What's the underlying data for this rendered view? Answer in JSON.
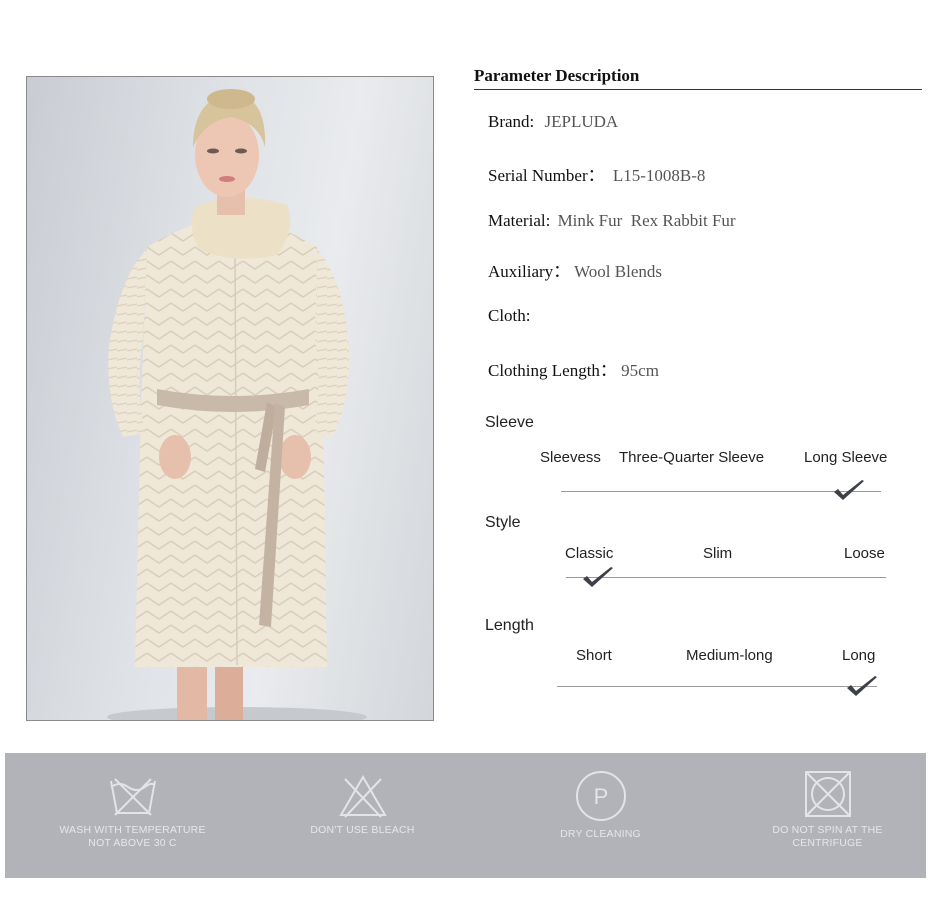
{
  "parameter": {
    "title": "Parameter Description",
    "brand_label": "Brand:",
    "brand_value": "JEPLUDA",
    "serial_label": "Serial Number：",
    "serial_value": "L15-1008B-8",
    "material_label": "Material:",
    "material_value": "Mink Fur  Rex Rabbit Fur",
    "auxiliary_label": "Auxiliary：",
    "auxiliary_value": "Wool Blends",
    "cloth_label": "Cloth:",
    "length_label": "Clothing Length：",
    "length_value": "95cm"
  },
  "sleeve": {
    "title": "Sleeve",
    "options": [
      "Sleevess",
      "Three-Quarter Sleeve",
      "Long Sleeve"
    ],
    "selected": "Long Sleeve"
  },
  "style": {
    "title": "Style",
    "options": [
      "Classic",
      "Slim",
      "Loose"
    ],
    "selected": "Classic"
  },
  "length": {
    "title": "Length",
    "options": [
      "Short",
      "Medium-long",
      "Long"
    ],
    "selected": "Long"
  },
  "care": {
    "wash": [
      "WASH WITH TEMPERATURE",
      "NOT ABOVE 30 C"
    ],
    "bleach": [
      "DON'T USE BLEACH"
    ],
    "dry": [
      "DRY CLEANING"
    ],
    "spin": [
      "DO NOT SPIN AT THE",
      "CENTRIFUGE"
    ],
    "dry_symbol": "P"
  },
  "colors": {
    "care_bar": "#b2b3b8",
    "coat": "#efe8d8",
    "belt": "#c9b9a9"
  }
}
